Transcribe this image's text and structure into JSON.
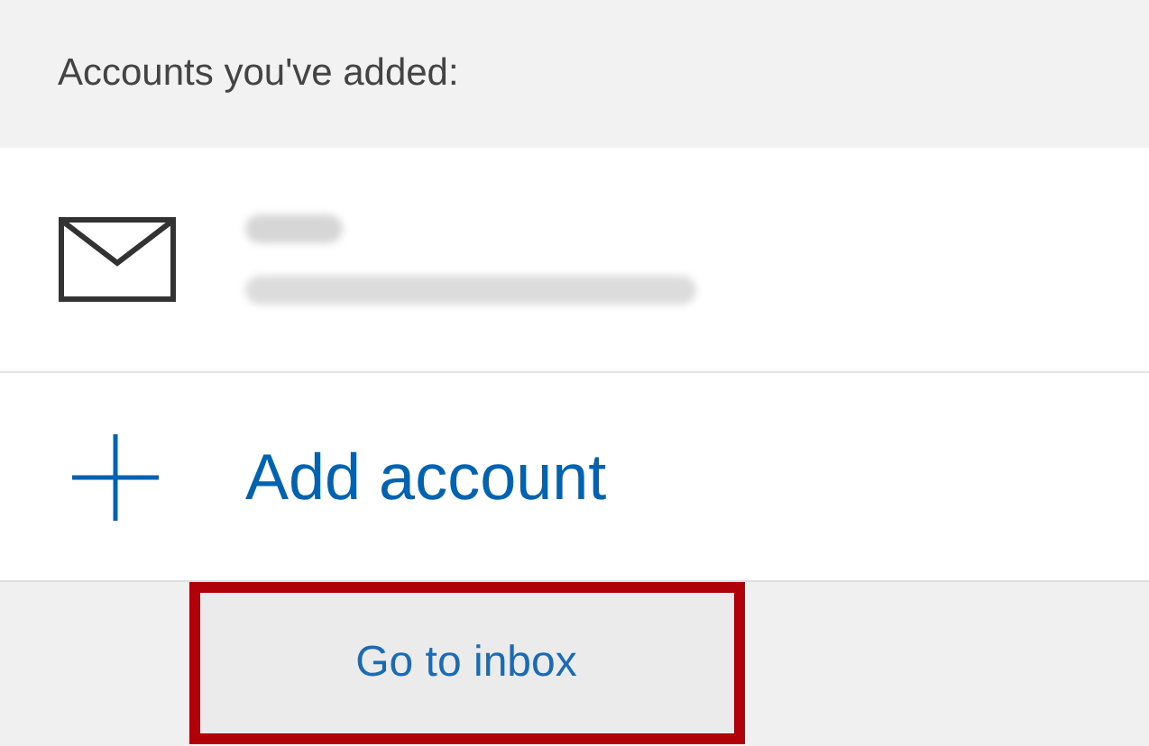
{
  "header": {
    "title": "Accounts you've added:"
  },
  "accounts": [
    {
      "kind": "mail"
    }
  ],
  "add_account": {
    "label": "Add account"
  },
  "footer": {
    "button": {
      "label": "Go to inbox",
      "highlighted": true
    }
  }
}
